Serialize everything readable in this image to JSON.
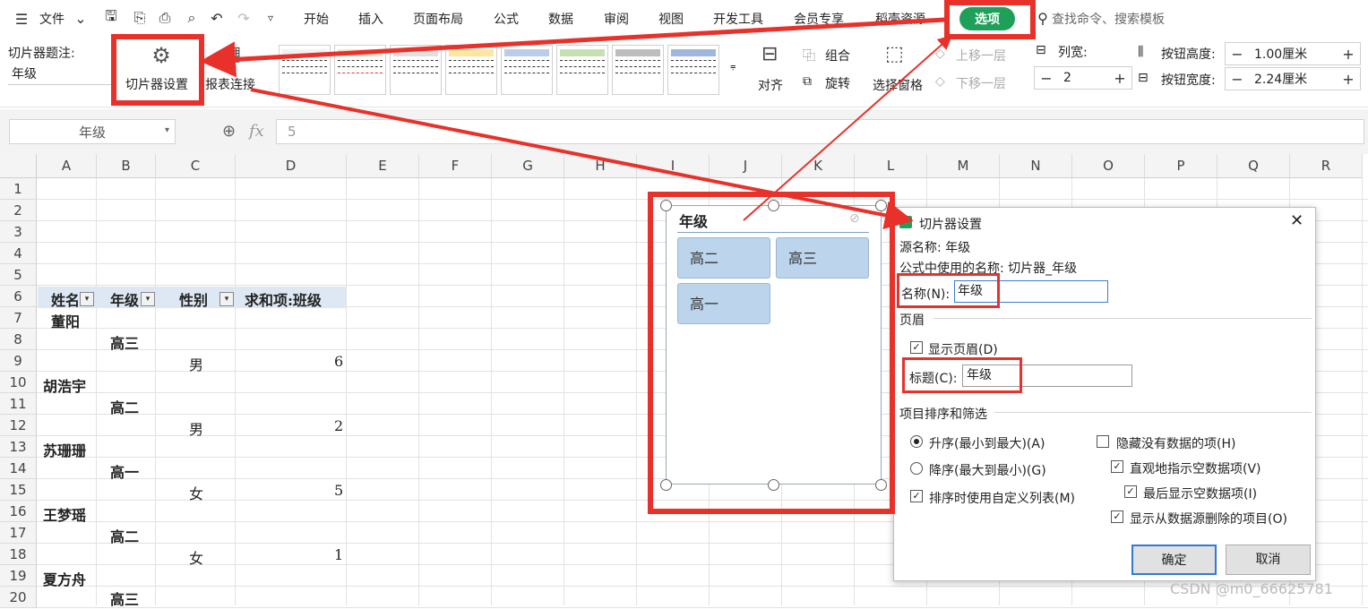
{
  "menubar": {
    "file_label": "文件",
    "tabs": [
      "开始",
      "插入",
      "页面布局",
      "公式",
      "数据",
      "审阅",
      "视图",
      "开发工具",
      "会员专享",
      "稻壳资源",
      "选项"
    ],
    "search_placeholder": "查找命令、搜索模板"
  },
  "ribbon": {
    "slicer_caption_label": "切片器题注:",
    "slicer_caption_value": "年级",
    "slicer_settings_label": "切片器设置",
    "report_connect_label": "报表连接",
    "align_label": "对齐",
    "group_label": "组合",
    "rotate_label": "旋转",
    "selection_pane_label": "选择窗格",
    "bring_forward_label": "上移一层",
    "send_backward_label": "下移一层",
    "columns_label": "列宽:",
    "columns_value": "2",
    "btn_height_label": "按钮高度:",
    "btn_height_value": "1.00厘米",
    "btn_width_label": "按钮宽度:",
    "btn_width_value": "2.24厘米"
  },
  "formula_bar": {
    "name_box": "年级",
    "fx": "fx",
    "value": "5"
  },
  "columns": [
    "A",
    "B",
    "C",
    "D",
    "E",
    "F",
    "G",
    "H",
    "I",
    "J",
    "K",
    "L",
    "M",
    "N",
    "O",
    "P",
    "Q",
    "R"
  ],
  "rows": [
    "1",
    "2",
    "3",
    "4",
    "5",
    "6",
    "7",
    "8",
    "9",
    "10",
    "11",
    "12",
    "13",
    "14",
    "15",
    "16",
    "17",
    "18",
    "19",
    "20"
  ],
  "pivot": {
    "headers": [
      "姓名",
      "年级",
      "性别",
      "求和项:班级"
    ],
    "names": [
      "董阳",
      "胡浩宇",
      "苏珊珊",
      "王梦瑶",
      "夏方舟"
    ],
    "grades": [
      "高三",
      "高二",
      "高一",
      "高二",
      "高三"
    ],
    "genders": [
      "男",
      "男",
      "女",
      "女"
    ],
    "values": [
      "6",
      "2",
      "5",
      "1"
    ]
  },
  "slicer": {
    "title": "年级",
    "items": [
      "高二",
      "高三",
      "高一"
    ]
  },
  "dialog": {
    "title": "切片器设置",
    "source_name": "源名称: 年级",
    "formula_name": "公式中使用的名称: 切片器_年级",
    "name_label": "名称(N):",
    "name_value": "年级",
    "header_section": "页眉",
    "show_header": "显示页眉(D)",
    "caption_label": "标题(C):",
    "caption_value": "年级",
    "sort_section": "项目排序和筛选",
    "ascending": "升序(最小到最大)(A)",
    "descending": "降序(最大到最小)(G)",
    "custom_list": "排序时使用自定义列表(M)",
    "hide_no_data": "隐藏没有数据的项(H)",
    "visual_empty": "直观地指示空数据项(V)",
    "show_empty_last": "最后显示空数据项(I)",
    "show_deleted": "显示从数据源删除的项目(O)",
    "ok": "确定",
    "cancel": "取消"
  },
  "watermark": "CSDN @m0_66625781",
  "colors": {
    "accent_green": "#1fa05a",
    "annotation_red": "#e8312a",
    "slicer_item": "#bcd5ec",
    "pivot_header": "#dde8f4"
  }
}
